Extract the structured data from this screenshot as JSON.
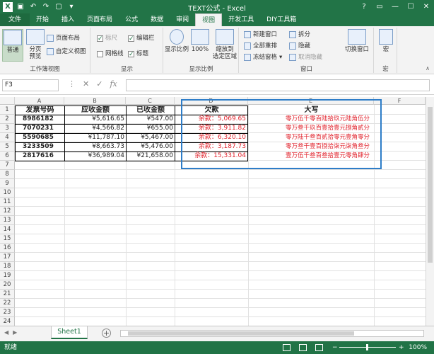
{
  "window": {
    "title": "TEXT公式 - Excel",
    "help": "?"
  },
  "ribbon_tabs": [
    "文件",
    "开始",
    "插入",
    "页面布局",
    "公式",
    "数据",
    "审阅",
    "视图",
    "开发工具",
    "DIY工具箱"
  ],
  "ribbon": {
    "workbook_views": {
      "label": "工作簿视图",
      "normal": "普通",
      "page_break": "分页\n预览",
      "page_layout": "页面布局",
      "custom_views": "自定义视图"
    },
    "show": {
      "label": "显示",
      "ruler": "标尺",
      "formula_bar": "编辑栏",
      "gridlines": "网格线",
      "headings": "标题"
    },
    "zoom": {
      "label": "显示比例",
      "zoom": "显示比例",
      "hundred": "100%",
      "zoom_to_selection": "缩放到\n选定区域"
    },
    "window": {
      "label": "窗口",
      "new_window": "新建窗口",
      "arrange_all": "全部重排",
      "freeze_panes": "冻结窗格",
      "split": "拆分",
      "hide": "隐藏",
      "unhide": "取消隐藏",
      "switch_windows": "切换窗口"
    },
    "macros": {
      "label": "宏",
      "macros": "宏"
    }
  },
  "formula_bar": {
    "name_box": "F3",
    "fx": "fx"
  },
  "columns": [
    "A",
    "B",
    "C",
    "D",
    "E",
    "F"
  ],
  "rows": [
    "1",
    "2",
    "3",
    "4",
    "5",
    "6",
    "7",
    "8",
    "9",
    "10",
    "11",
    "12",
    "13",
    "14",
    "15",
    "16",
    "17",
    "18",
    "19",
    "20",
    "21",
    "22",
    "23",
    "24"
  ],
  "table": {
    "headers": [
      "发票号码",
      "应收金额",
      "已收金额",
      "欠款",
      "大写"
    ],
    "data": [
      [
        "8986182",
        "¥5,616.65",
        "¥547.00",
        "余款：5,069.65",
        "零万伍千零百陆拾玖元陆角伍分"
      ],
      [
        "7070231",
        "¥4,566.82",
        "¥655.00",
        "余款：3,911.82",
        "零万叁千玖百壹拾壹元捌角贰分"
      ],
      [
        "5590685",
        "¥11,787.10",
        "¥5,467.00",
        "余款：6,320.10",
        "零万陆千叁百贰拾零元壹角零分"
      ],
      [
        "3233509",
        "¥8,663.73",
        "¥5,476.00",
        "余款：3,187.73",
        "零万叁千壹百捌拾柒元柒角叁分"
      ],
      [
        "2817616",
        "¥36,989.04",
        "¥21,658.00",
        "余款：15,331.04",
        "壹万伍千叁百叁拾壹元零角肆分"
      ]
    ]
  },
  "sheets": {
    "active": "Sheet1",
    "add": "+"
  },
  "status": {
    "ready": "就绪",
    "zoom": "100%",
    "minus": "−",
    "plus": "+"
  }
}
